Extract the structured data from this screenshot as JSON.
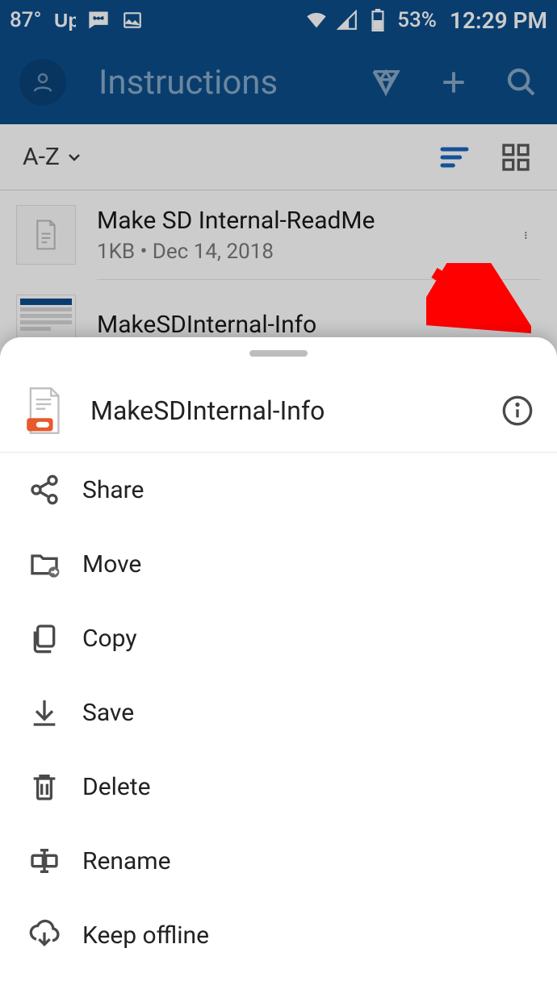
{
  "status": {
    "temperature": "87°",
    "battery_pct": "53%",
    "time": "12:29 PM"
  },
  "appbar": {
    "title": "Instructions"
  },
  "sort": {
    "label": "A-Z"
  },
  "files": [
    {
      "name": "Make SD Internal-ReadMe",
      "meta_size": "1KB",
      "meta_date": "Dec 14, 2018"
    },
    {
      "name": "MakeSDInternal-Info"
    }
  ],
  "sheet": {
    "title": "MakeSDInternal-Info",
    "actions": {
      "share": "Share",
      "move": "Move",
      "copy": "Copy",
      "save": "Save",
      "delete": "Delete",
      "rename": "Rename",
      "keep_offline": "Keep offline"
    }
  }
}
